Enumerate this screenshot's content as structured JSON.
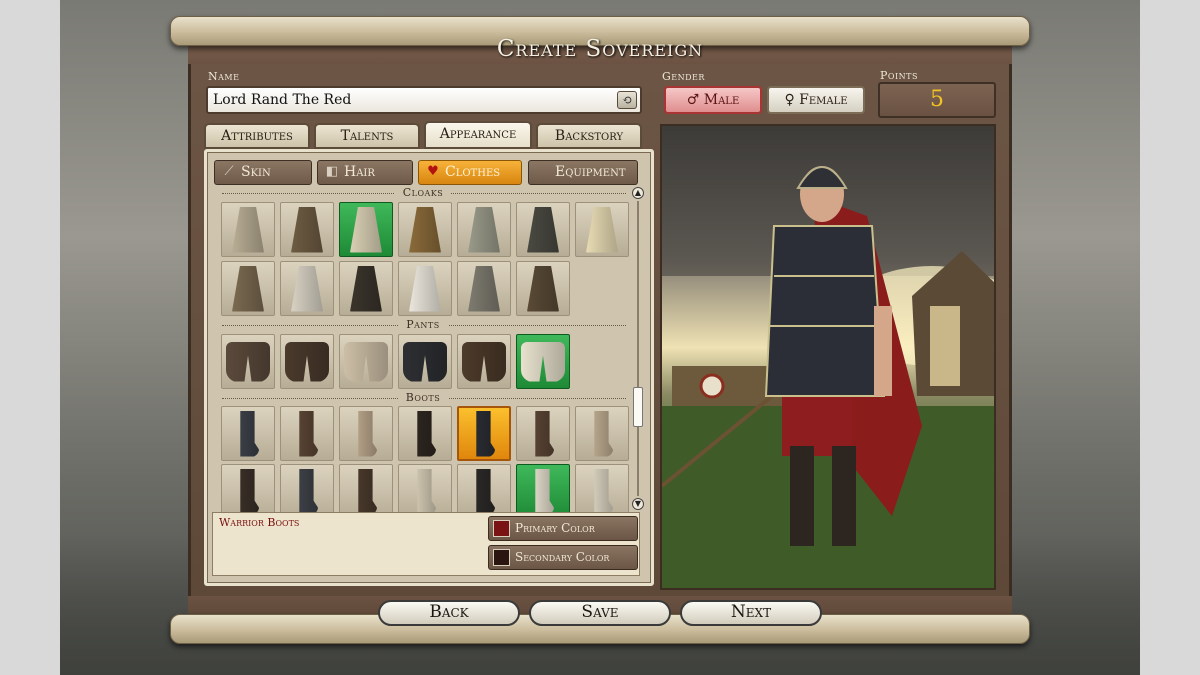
{
  "title": "Create Sovereign",
  "name_section": {
    "label": "Name",
    "value": "Lord Rand The Red",
    "random_glyph": "⟲"
  },
  "gender": {
    "label": "Gender",
    "options": [
      {
        "label": "Male",
        "symbol": "♂",
        "selected": true
      },
      {
        "label": "Female",
        "symbol": "♀",
        "selected": false
      }
    ]
  },
  "points": {
    "label": "Points",
    "value": "5"
  },
  "tabs": [
    {
      "label": "Attributes",
      "active": false
    },
    {
      "label": "Talents",
      "active": false
    },
    {
      "label": "Appearance",
      "active": true
    },
    {
      "label": "Backstory",
      "active": false
    }
  ],
  "subtabs": [
    {
      "label": "Skin",
      "icon": "knife-icon",
      "active": false
    },
    {
      "label": "Hair",
      "icon": "comb-icon",
      "active": false
    },
    {
      "label": "Clothes",
      "icon": "heart-icon",
      "active": true
    },
    {
      "label": "Equipment",
      "icon": "",
      "active": false
    }
  ],
  "sections": {
    "cloaks": {
      "label": "Cloaks",
      "items": [
        {
          "color": "#b8ad94",
          "selected": false
        },
        {
          "color": "#6e5c43",
          "selected": false
        },
        {
          "color": "#d9d0b4",
          "selected": true
        },
        {
          "color": "#8a6a3a",
          "selected": false
        },
        {
          "color": "#9a9a8a",
          "selected": false
        },
        {
          "color": "#4a4a42",
          "selected": false
        },
        {
          "color": "#e8dcb4",
          "selected": false
        },
        {
          "color": "#7a6a50",
          "selected": false
        },
        {
          "color": "#d8d2c4",
          "selected": false
        },
        {
          "color": "#3a342c",
          "selected": false
        },
        {
          "color": "#ebe7dd",
          "selected": false
        },
        {
          "color": "#7e7b70",
          "selected": false
        },
        {
          "color": "#5a4a36",
          "selected": false
        }
      ]
    },
    "pants": {
      "label": "Pants",
      "items": [
        {
          "color": "#5b4a3c",
          "selected": false
        },
        {
          "color": "#4a3a2d",
          "selected": false
        },
        {
          "color": "#cdbfa6",
          "selected": false
        },
        {
          "color": "#2d2f33",
          "selected": false
        },
        {
          "color": "#4c3a2a",
          "selected": false
        },
        {
          "color": "#e7e1cd",
          "selected": true
        }
      ]
    },
    "boots": {
      "label": "Boots",
      "items": [
        {
          "color": "#3c4048",
          "selected": false,
          "highlight": ""
        },
        {
          "color": "#5b4535",
          "selected": false,
          "highlight": ""
        },
        {
          "color": "#b8a48a",
          "selected": false,
          "highlight": ""
        },
        {
          "color": "#2e2620",
          "selected": false,
          "highlight": ""
        },
        {
          "color": "#2a2d33",
          "selected": true,
          "highlight": "gold"
        },
        {
          "color": "#5a4434",
          "selected": false,
          "highlight": ""
        },
        {
          "color": "#bcaa90",
          "selected": false,
          "highlight": ""
        },
        {
          "color": "#3a3028",
          "selected": false,
          "highlight": ""
        },
        {
          "color": "#3e4248",
          "selected": false,
          "highlight": ""
        },
        {
          "color": "#4a3a2c",
          "selected": false,
          "highlight": ""
        },
        {
          "color": "#d4cab4",
          "selected": false,
          "highlight": ""
        },
        {
          "color": "#2c2a28",
          "selected": false,
          "highlight": ""
        },
        {
          "color": "#e2dccb",
          "selected": false,
          "highlight": "green"
        },
        {
          "color": "#d9d2c0",
          "selected": false,
          "highlight": ""
        }
      ]
    }
  },
  "selected_item": {
    "name": "Warrior Boots"
  },
  "colors": {
    "primary": {
      "label": "Primary Color",
      "swatch": "#7a1414"
    },
    "secondary": {
      "label": "Secondary Color",
      "swatch": "#2a1510"
    }
  },
  "buttons": {
    "back": "Back",
    "save": "Save",
    "next": "Next"
  }
}
